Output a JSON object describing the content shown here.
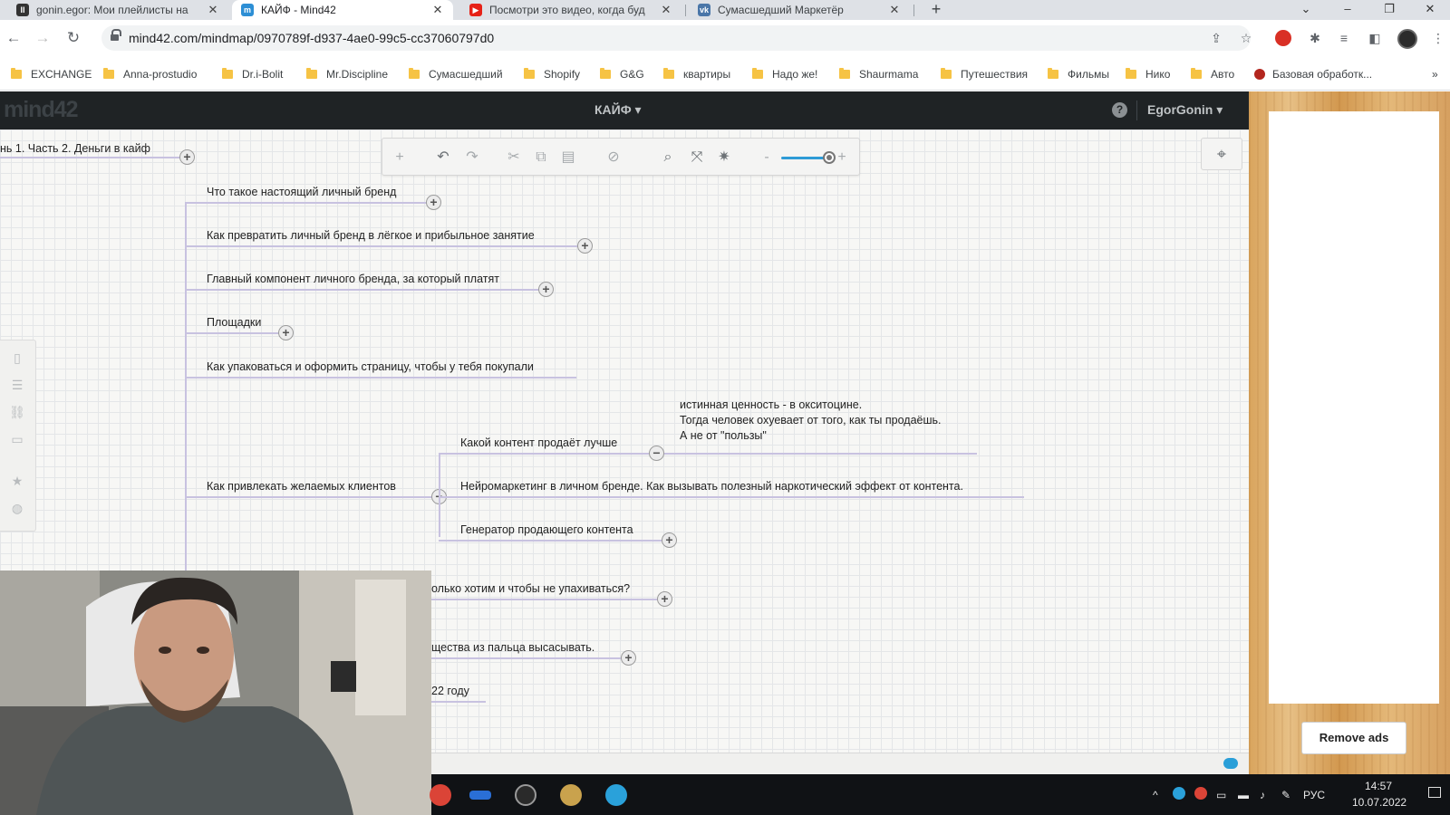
{
  "browser": {
    "tabs": [
      {
        "title": "gonin.egor: Мои плейлисты на",
        "close": "✕"
      },
      {
        "title": "КАЙФ - Mind42",
        "close": "✕"
      },
      {
        "title": "Посмотри это видео, когда буд",
        "close": "✕"
      },
      {
        "title": "Сумасшедший Маркетёр",
        "close": "✕"
      }
    ],
    "new_tab": "+",
    "url": "mind42.com/mindmap/0970789f-d937-4ae0-99c5-cc37060797d0",
    "bookmarks": [
      "EXCHANGE",
      "Anna-prostudio",
      "Dr.i-Bolit",
      "Mr.Discipline",
      "Сумасшедший",
      "Shopify",
      "G&G",
      "квартиры",
      "Надо же!",
      "Shaurmama",
      "Путешествия",
      "Фильмы",
      "Нико",
      "Авто",
      "Базовая обработк..."
    ],
    "more_bookmarks": "»"
  },
  "app": {
    "logo": "mind42",
    "map_name": "КАЙФ ▾",
    "help": "?",
    "user": "EgorGonin ▾"
  },
  "mindmap": {
    "root": "нь 1. Часть 2. Деньги в кайф",
    "branches": [
      "Что такое настоящий личный бренд",
      "Как превратить личный бренд в лёгкое и прибыльное занятие",
      "Главный компонент личного бренда, за который платят",
      "Площадки",
      "Как упаковаться и оформить страницу, чтобы у тебя покупали",
      "Как привлекать желаемых клиентов"
    ],
    "sub_branches": [
      "Какой контент продаёт лучше",
      "Нейромаркетинг в личном бренде. Как вызывать полезный наркотический эффект от контента.",
      "Генератор продающего контента"
    ],
    "note_lines": [
      "истинная ценность - в окситоцине.",
      "Тогда человек охуевает от того, как ты продаёшь.",
      "А не от \"пользы\""
    ],
    "partial_nodes": [
      "олько хотим и чтобы не упахиваться?",
      "щества из пальца высасывать.",
      "22 году"
    ],
    "expand": "+",
    "collapse": "−"
  },
  "ads": {
    "remove_ads": "Remove ads"
  },
  "taskbar": {
    "lang": "РУС",
    "time": "14:57",
    "date": "10.07.2022"
  },
  "colors": {
    "header_bg": "#1f2325",
    "branch_line": "#c8c2e0",
    "accent": "#2e9bd6"
  },
  "icons": [
    "new-node-icon",
    "undo-icon",
    "redo-icon",
    "cut-icon",
    "copy-icon",
    "paste-icon",
    "delete-icon",
    "search-icon",
    "fit-icon",
    "expand-all-icon",
    "zoom-slider",
    "locate-icon"
  ]
}
